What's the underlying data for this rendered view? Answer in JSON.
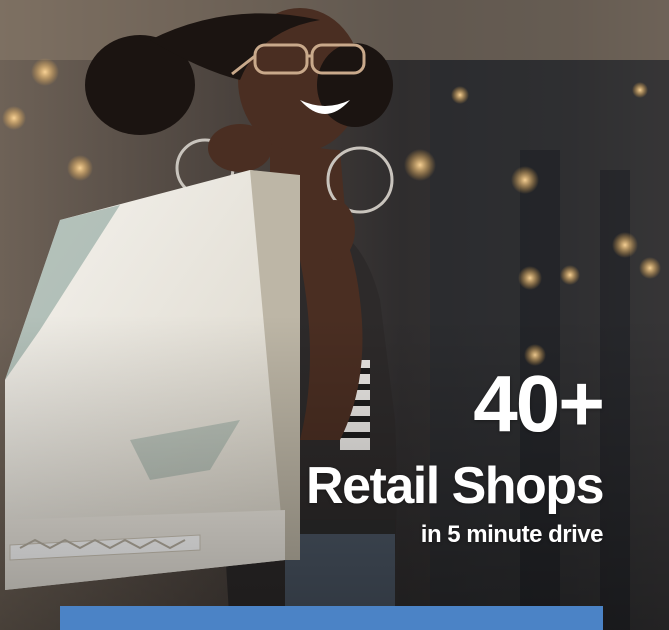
{
  "promo": {
    "stat": "40+",
    "title": "Retail Shops",
    "subtitle": "in 5 minute drive"
  },
  "photo": {
    "subject": "woman-with-shopping-bags-icon"
  },
  "colors": {
    "accent_bar": "#4b83c6",
    "text": "#ffffff"
  }
}
